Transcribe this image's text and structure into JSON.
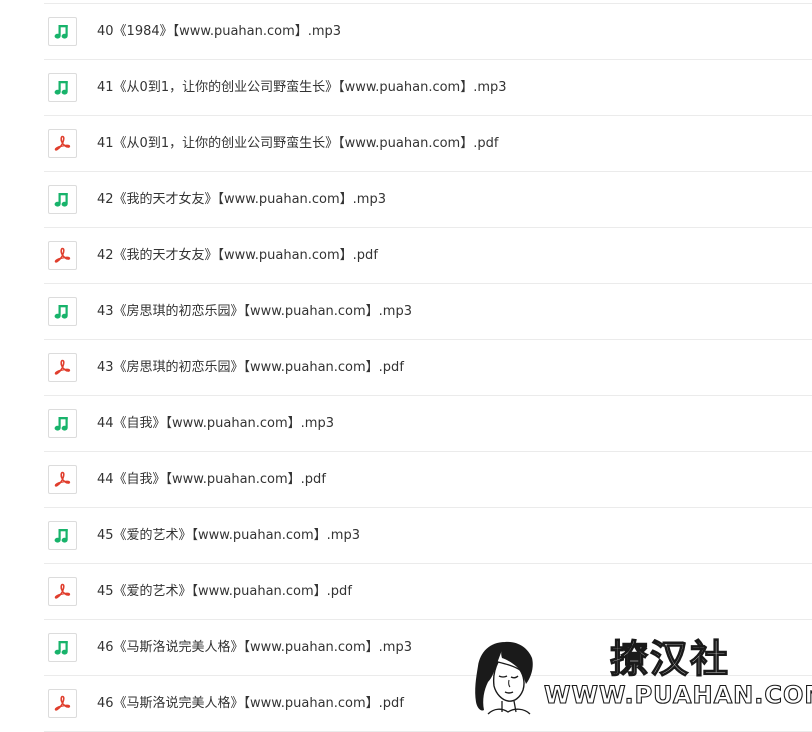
{
  "icon_colors": {
    "audio": "#18b36b",
    "pdf": "#e03e2d"
  },
  "files": [
    {
      "type": "audio",
      "icon": "music-note-icon",
      "name": "40《1984》【www.puahan.com】.mp3"
    },
    {
      "type": "audio",
      "icon": "music-note-icon",
      "name": "41《从0到1，让你的创业公司野蛮生长》【www.puahan.com】.mp3"
    },
    {
      "type": "pdf",
      "icon": "pdf-icon",
      "name": "41《从0到1，让你的创业公司野蛮生长》【www.puahan.com】.pdf"
    },
    {
      "type": "audio",
      "icon": "music-note-icon",
      "name": "42《我的天才女友》【www.puahan.com】.mp3"
    },
    {
      "type": "pdf",
      "icon": "pdf-icon",
      "name": "42《我的天才女友》【www.puahan.com】.pdf"
    },
    {
      "type": "audio",
      "icon": "music-note-icon",
      "name": "43《房思琪的初恋乐园》【www.puahan.com】.mp3"
    },
    {
      "type": "pdf",
      "icon": "pdf-icon",
      "name": "43《房思琪的初恋乐园》【www.puahan.com】.pdf"
    },
    {
      "type": "audio",
      "icon": "music-note-icon",
      "name": "44《自我》【www.puahan.com】.mp3"
    },
    {
      "type": "pdf",
      "icon": "pdf-icon",
      "name": "44《自我》【www.puahan.com】.pdf"
    },
    {
      "type": "audio",
      "icon": "music-note-icon",
      "name": "45《爱的艺术》【www.puahan.com】.mp3"
    },
    {
      "type": "pdf",
      "icon": "pdf-icon",
      "name": "45《爱的艺术》【www.puahan.com】.pdf"
    },
    {
      "type": "audio",
      "icon": "music-note-icon",
      "name": "46《马斯洛说完美人格》【www.puahan.com】.mp3"
    },
    {
      "type": "pdf",
      "icon": "pdf-icon",
      "name": "46《马斯洛说完美人格》【www.puahan.com】.pdf"
    }
  ],
  "watermark": {
    "chinese_text": "撩汉社",
    "url_text": "WWW.PUAHAN.COM"
  }
}
